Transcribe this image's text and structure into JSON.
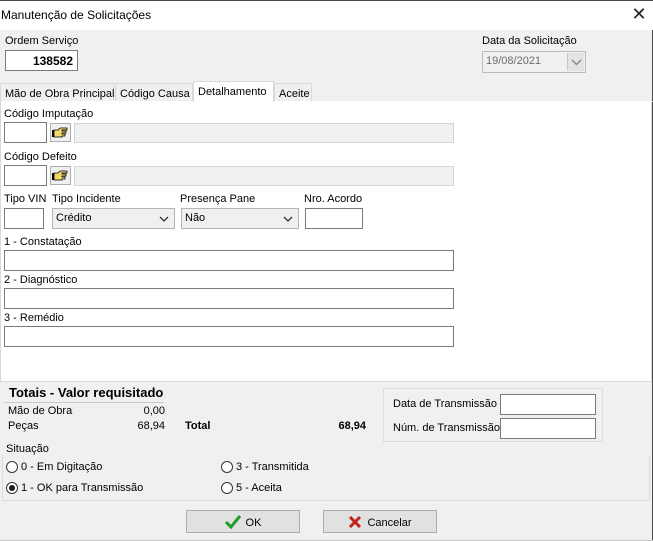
{
  "window": {
    "title": "Manutenção de Solicitações",
    "close_glyph": "✕"
  },
  "header": {
    "ordem_label": "Ordem Serviço",
    "ordem_value": "138582",
    "data_label": "Data da Solicitação",
    "data_value": "19/08/2021"
  },
  "tabs": [
    {
      "label": "Mão de Obra Principal",
      "active": false
    },
    {
      "label": "Código Causa",
      "active": false
    },
    {
      "label": "Detalhamento",
      "active": true
    },
    {
      "label": "Aceite",
      "active": false
    }
  ],
  "detail": {
    "imputacao_label": "Código Imputação",
    "imputacao_code": "",
    "imputacao_desc": "",
    "defeito_label": "Código Defeito",
    "defeito_code": "",
    "defeito_desc": "",
    "tipo_vin_label": "Tipo VIN",
    "tipo_vin_value": "",
    "tipo_incidente_label": "Tipo Incidente",
    "tipo_incidente_value": "Crédito",
    "presenca_label": "Presença Pane",
    "presenca_value": "Não",
    "acordo_label": "Nro. Acordo",
    "acordo_value": "",
    "constatacao_label": "1 - Constatação",
    "constatacao_value": "",
    "diagnostico_label": "2 - Diagnóstico",
    "diagnostico_value": "",
    "remedio_label": "3 - Remédio",
    "remedio_value": "",
    "lookup_icon": "pointing-hand-icon"
  },
  "totals": {
    "title": "Totais - Valor requisitado",
    "mao_label": "Mão de Obra",
    "mao_value": "0,00",
    "pecas_label": "Peças",
    "pecas_value": "68,94",
    "total_label": "Total",
    "total_value": "68,94"
  },
  "transmission": {
    "data_label": "Data de Transmissão",
    "data_value": "",
    "num_label": "Núm. de Transmissão",
    "num_value": ""
  },
  "situacao": {
    "label": "Situação",
    "options": [
      {
        "label": "0 - Em Digitação",
        "checked": false
      },
      {
        "label": "1 - OK para Transmissão",
        "checked": true
      },
      {
        "label": "3 - Transmitida",
        "checked": false
      },
      {
        "label": "5 - Aceita",
        "checked": false
      }
    ]
  },
  "buttons": {
    "ok_label": "OK",
    "cancel_label": "Cancelar",
    "ok_icon_color": "#1e9e2a",
    "cancel_icon_color": "#c0201a"
  }
}
